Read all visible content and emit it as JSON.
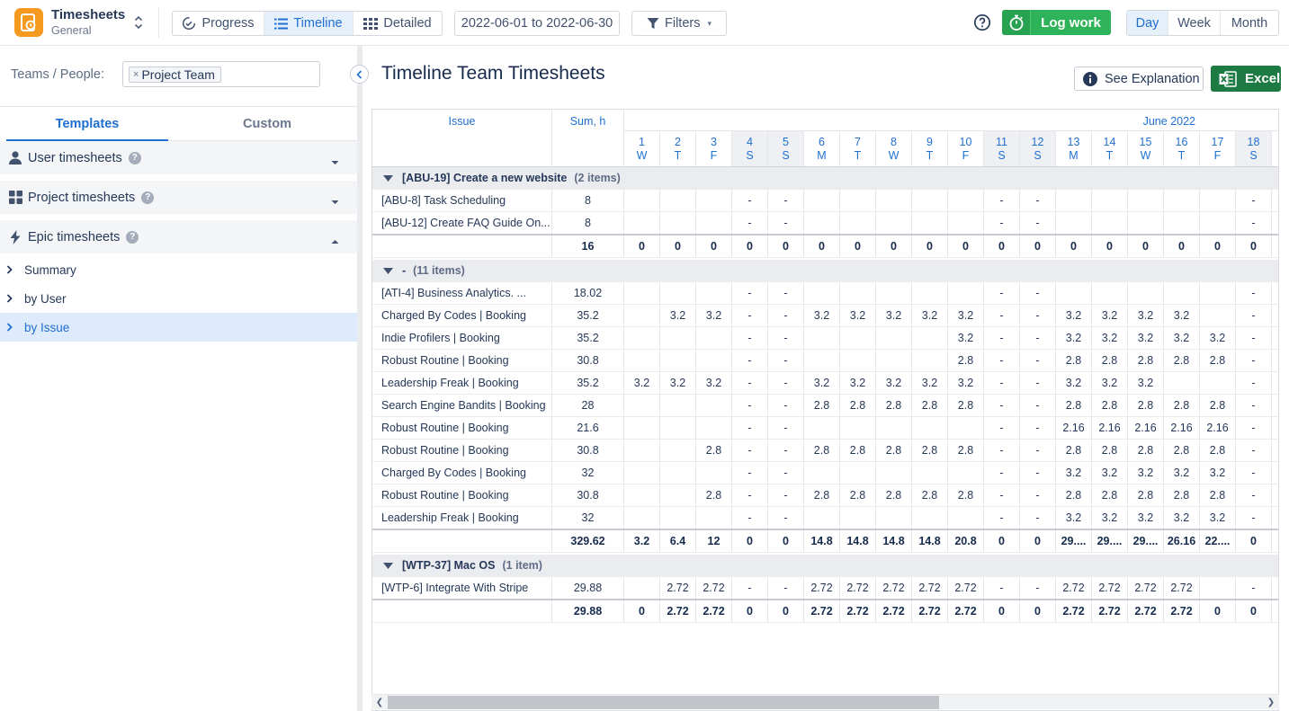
{
  "app": {
    "title": "Timesheets",
    "subtitle": "General"
  },
  "view_tabs": [
    {
      "label": "Progress",
      "icon": "progress-icon",
      "active": false
    },
    {
      "label": "Timeline",
      "icon": "timeline-icon",
      "active": true
    },
    {
      "label": "Detailed",
      "icon": "detailed-grid-icon",
      "active": false
    }
  ],
  "date_range": "2022-06-01 to 2022-06-30",
  "filters_label": "Filters",
  "log_work_label": "Log work",
  "period_tabs": [
    {
      "label": "Day",
      "active": true
    },
    {
      "label": "Week",
      "active": false
    },
    {
      "label": "Month",
      "active": false
    }
  ],
  "left": {
    "teams_label": "Teams / People:",
    "selected_team": "Project Team",
    "tabs": [
      {
        "label": "Templates",
        "active": true
      },
      {
        "label": "Custom",
        "active": false
      }
    ],
    "sections": [
      {
        "title": "User timesheets",
        "icon": "user-icon",
        "expanded": false
      },
      {
        "title": "Project timesheets",
        "icon": "grid-icon",
        "expanded": false
      },
      {
        "title": "Epic timesheets",
        "icon": "lightning-icon",
        "expanded": true
      }
    ],
    "epic_items": [
      {
        "label": "Summary",
        "active": false
      },
      {
        "label": "by User",
        "active": false
      },
      {
        "label": "by Issue",
        "active": true
      }
    ]
  },
  "main": {
    "title": "Timeline Team Timesheets",
    "see_explanation_label": "See Explanation",
    "excel_label": "Excel"
  },
  "grid": {
    "issue_header": "Issue",
    "sum_header": "Sum, h",
    "month_header": "June 2022",
    "days": [
      {
        "d": "1",
        "w": "W",
        "we": false
      },
      {
        "d": "2",
        "w": "T",
        "we": false
      },
      {
        "d": "3",
        "w": "F",
        "we": false
      },
      {
        "d": "4",
        "w": "S",
        "we": true
      },
      {
        "d": "5",
        "w": "S",
        "we": true
      },
      {
        "d": "6",
        "w": "M",
        "we": false
      },
      {
        "d": "7",
        "w": "T",
        "we": false
      },
      {
        "d": "8",
        "w": "W",
        "we": false
      },
      {
        "d": "9",
        "w": "T",
        "we": false
      },
      {
        "d": "10",
        "w": "F",
        "we": false
      },
      {
        "d": "11",
        "w": "S",
        "we": true
      },
      {
        "d": "12",
        "w": "S",
        "we": true
      },
      {
        "d": "13",
        "w": "M",
        "we": false
      },
      {
        "d": "14",
        "w": "T",
        "we": false
      },
      {
        "d": "15",
        "w": "W",
        "we": false
      },
      {
        "d": "16",
        "w": "T",
        "we": false
      },
      {
        "d": "17",
        "w": "F",
        "we": false
      },
      {
        "d": "18",
        "w": "S",
        "we": true
      }
    ],
    "groups": [
      {
        "title": "[ABU-19] Create a new website",
        "count": "(2 items)",
        "rows": [
          {
            "issue": "[ABU-8] Task Scheduling",
            "sum": "8",
            "cells": [
              "",
              "",
              "",
              "-",
              "-",
              "",
              "",
              "",
              "",
              "",
              "-",
              "-",
              "",
              "",
              "",
              "",
              "",
              "-"
            ]
          },
          {
            "issue": "[ABU-12] Create FAQ Guide On...",
            "sum": "8",
            "cells": [
              "",
              "",
              "",
              "-",
              "-",
              "",
              "",
              "",
              "",
              "",
              "-",
              "-",
              "",
              "",
              "",
              "",
              "",
              "-"
            ]
          }
        ],
        "total": {
          "sum": "16",
          "cells": [
            "0",
            "0",
            "0",
            "0",
            "0",
            "0",
            "0",
            "0",
            "0",
            "0",
            "0",
            "0",
            "0",
            "0",
            "0",
            "0",
            "0",
            "0"
          ]
        }
      },
      {
        "title": "-",
        "count": "(11 items)",
        "rows": [
          {
            "issue": "[ATI-4] Business Analytics. ...",
            "sum": "18.02",
            "cells": [
              "",
              "",
              "",
              "-",
              "-",
              "",
              "",
              "",
              "",
              "",
              "-",
              "-",
              "",
              "",
              "",
              "",
              "",
              "-"
            ]
          },
          {
            "issue": "Charged By Codes | Booking",
            "sum": "35.2",
            "cells": [
              "",
              "3.2",
              "3.2",
              "-",
              "-",
              "3.2",
              "3.2",
              "3.2",
              "3.2",
              "3.2",
              "-",
              "-",
              "3.2",
              "3.2",
              "3.2",
              "3.2",
              "",
              "-"
            ]
          },
          {
            "issue": "Indie Profilers | Booking",
            "sum": "35.2",
            "cells": [
              "",
              "",
              "",
              "-",
              "-",
              "",
              "",
              "",
              "",
              "3.2",
              "-",
              "-",
              "3.2",
              "3.2",
              "3.2",
              "3.2",
              "3.2",
              "-"
            ]
          },
          {
            "issue": "Robust Routine | Booking",
            "sum": "30.8",
            "cells": [
              "",
              "",
              "",
              "-",
              "-",
              "",
              "",
              "",
              "",
              "2.8",
              "-",
              "-",
              "2.8",
              "2.8",
              "2.8",
              "2.8",
              "2.8",
              "-"
            ]
          },
          {
            "issue": "Leadership Freak | Booking",
            "sum": "35.2",
            "cells": [
              "3.2",
              "3.2",
              "3.2",
              "-",
              "-",
              "3.2",
              "3.2",
              "3.2",
              "3.2",
              "3.2",
              "-",
              "-",
              "3.2",
              "3.2",
              "3.2",
              "",
              "",
              "-"
            ]
          },
          {
            "issue": "Search Engine Bandits | Booking",
            "sum": "28",
            "cells": [
              "",
              "",
              "",
              "-",
              "-",
              "2.8",
              "2.8",
              "2.8",
              "2.8",
              "2.8",
              "-",
              "-",
              "2.8",
              "2.8",
              "2.8",
              "2.8",
              "2.8",
              "-"
            ]
          },
          {
            "issue": "Robust Routine | Booking",
            "sum": "21.6",
            "cells": [
              "",
              "",
              "",
              "-",
              "-",
              "",
              "",
              "",
              "",
              "",
              "-",
              "-",
              "2.16",
              "2.16",
              "2.16",
              "2.16",
              "2.16",
              "-"
            ]
          },
          {
            "issue": "Robust Routine | Booking",
            "sum": "30.8",
            "cells": [
              "",
              "",
              "2.8",
              "-",
              "-",
              "2.8",
              "2.8",
              "2.8",
              "2.8",
              "2.8",
              "-",
              "-",
              "2.8",
              "2.8",
              "2.8",
              "2.8",
              "2.8",
              "-"
            ]
          },
          {
            "issue": "Charged By Codes | Booking",
            "sum": "32",
            "cells": [
              "",
              "",
              "",
              "-",
              "-",
              "",
              "",
              "",
              "",
              "",
              "-",
              "-",
              "3.2",
              "3.2",
              "3.2",
              "3.2",
              "3.2",
              "-"
            ]
          },
          {
            "issue": "Robust Routine | Booking",
            "sum": "30.8",
            "cells": [
              "",
              "",
              "2.8",
              "-",
              "-",
              "2.8",
              "2.8",
              "2.8",
              "2.8",
              "2.8",
              "-",
              "-",
              "2.8",
              "2.8",
              "2.8",
              "2.8",
              "2.8",
              "-"
            ]
          },
          {
            "issue": "Leadership Freak | Booking",
            "sum": "32",
            "cells": [
              "",
              "",
              "",
              "-",
              "-",
              "",
              "",
              "",
              "",
              "",
              "-",
              "-",
              "3.2",
              "3.2",
              "3.2",
              "3.2",
              "3.2",
              "-"
            ]
          }
        ],
        "total": {
          "sum": "329.62",
          "cells": [
            "3.2",
            "6.4",
            "12",
            "0",
            "0",
            "14.8",
            "14.8",
            "14.8",
            "14.8",
            "20.8",
            "0",
            "0",
            "29....",
            "29....",
            "29....",
            "26.16",
            "22....",
            "0"
          ]
        }
      },
      {
        "title": "[WTP-37] Mac OS",
        "count": "(1 item)",
        "rows": [
          {
            "issue": "[WTP-6] Integrate With Stripe",
            "sum": "29.88",
            "cells": [
              "",
              "2.72",
              "2.72",
              "-",
              "-",
              "2.72",
              "2.72",
              "2.72",
              "2.72",
              "2.72",
              "-",
              "-",
              "2.72",
              "2.72",
              "2.72",
              "2.72",
              "",
              "-"
            ]
          }
        ],
        "total": {
          "sum": "29.88",
          "cells": [
            "0",
            "2.72",
            "2.72",
            "0",
            "0",
            "2.72",
            "2.72",
            "2.72",
            "2.72",
            "2.72",
            "0",
            "0",
            "2.72",
            "2.72",
            "2.72",
            "2.72",
            "0",
            "0"
          ]
        }
      }
    ]
  }
}
